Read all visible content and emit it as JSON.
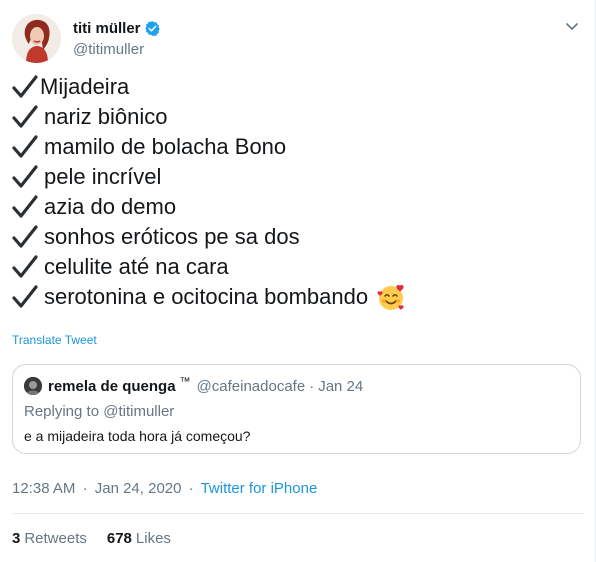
{
  "author": {
    "display_name": "titi müller",
    "handle": "@titimuller",
    "verified_icon": "verified-badge-icon",
    "verified_color": "#1da1f2"
  },
  "tweet": {
    "lines": [
      "Mijadeira",
      "nariz biônico",
      "mamilo de bolacha Bono",
      "pele incrível",
      "azia do demo",
      "sonhos eróticos pe sa dos",
      "celulite até na cara",
      "serotonina e ocitocina bombando"
    ],
    "check_icon": "heavy-check-mark-icon",
    "emoji_icon": "smiling-face-with-hearts-icon"
  },
  "translate_label": "Translate Tweet",
  "quoted_tweet": {
    "display_name": "remela de quenga",
    "name_suffix": "™",
    "handle": "@cafeinadocafe",
    "separator": "·",
    "date": "Jan 24",
    "replying_prefix": "Replying to",
    "replying_handle": "@titimuller",
    "text": "e a mijadeira toda hora já começou?"
  },
  "meta": {
    "time": "12:38 AM",
    "date": "Jan 24, 2020",
    "separator": "·",
    "source": "Twitter for iPhone"
  },
  "stats": {
    "retweets_count": "3",
    "retweets_label": "Retweets",
    "likes_count": "678",
    "likes_label": "Likes"
  },
  "colors": {
    "link": "#1b95e0",
    "secondary_text": "#657786",
    "primary_text": "#14171a",
    "border": "#ccd6dd"
  }
}
